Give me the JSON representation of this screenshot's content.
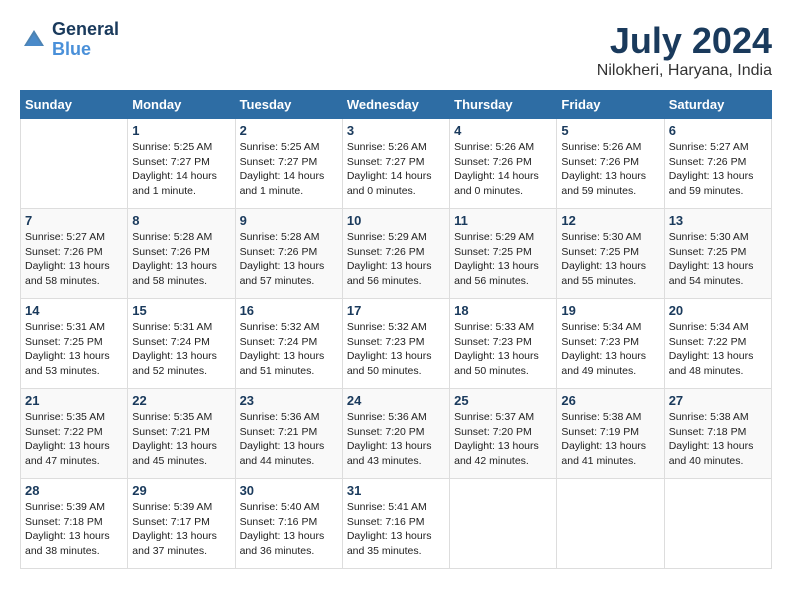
{
  "header": {
    "logo_line1": "General",
    "logo_line2": "Blue",
    "month": "July 2024",
    "location": "Nilokheri, Haryana, India"
  },
  "days_of_week": [
    "Sunday",
    "Monday",
    "Tuesday",
    "Wednesday",
    "Thursday",
    "Friday",
    "Saturday"
  ],
  "weeks": [
    [
      {
        "day": "",
        "info": ""
      },
      {
        "day": "1",
        "info": "Sunrise: 5:25 AM\nSunset: 7:27 PM\nDaylight: 14 hours\nand 1 minute."
      },
      {
        "day": "2",
        "info": "Sunrise: 5:25 AM\nSunset: 7:27 PM\nDaylight: 14 hours\nand 1 minute."
      },
      {
        "day": "3",
        "info": "Sunrise: 5:26 AM\nSunset: 7:27 PM\nDaylight: 14 hours\nand 0 minutes."
      },
      {
        "day": "4",
        "info": "Sunrise: 5:26 AM\nSunset: 7:26 PM\nDaylight: 14 hours\nand 0 minutes."
      },
      {
        "day": "5",
        "info": "Sunrise: 5:26 AM\nSunset: 7:26 PM\nDaylight: 13 hours\nand 59 minutes."
      },
      {
        "day": "6",
        "info": "Sunrise: 5:27 AM\nSunset: 7:26 PM\nDaylight: 13 hours\nand 59 minutes."
      }
    ],
    [
      {
        "day": "7",
        "info": "Sunrise: 5:27 AM\nSunset: 7:26 PM\nDaylight: 13 hours\nand 58 minutes."
      },
      {
        "day": "8",
        "info": "Sunrise: 5:28 AM\nSunset: 7:26 PM\nDaylight: 13 hours\nand 58 minutes."
      },
      {
        "day": "9",
        "info": "Sunrise: 5:28 AM\nSunset: 7:26 PM\nDaylight: 13 hours\nand 57 minutes."
      },
      {
        "day": "10",
        "info": "Sunrise: 5:29 AM\nSunset: 7:26 PM\nDaylight: 13 hours\nand 56 minutes."
      },
      {
        "day": "11",
        "info": "Sunrise: 5:29 AM\nSunset: 7:25 PM\nDaylight: 13 hours\nand 56 minutes."
      },
      {
        "day": "12",
        "info": "Sunrise: 5:30 AM\nSunset: 7:25 PM\nDaylight: 13 hours\nand 55 minutes."
      },
      {
        "day": "13",
        "info": "Sunrise: 5:30 AM\nSunset: 7:25 PM\nDaylight: 13 hours\nand 54 minutes."
      }
    ],
    [
      {
        "day": "14",
        "info": "Sunrise: 5:31 AM\nSunset: 7:25 PM\nDaylight: 13 hours\nand 53 minutes."
      },
      {
        "day": "15",
        "info": "Sunrise: 5:31 AM\nSunset: 7:24 PM\nDaylight: 13 hours\nand 52 minutes."
      },
      {
        "day": "16",
        "info": "Sunrise: 5:32 AM\nSunset: 7:24 PM\nDaylight: 13 hours\nand 51 minutes."
      },
      {
        "day": "17",
        "info": "Sunrise: 5:32 AM\nSunset: 7:23 PM\nDaylight: 13 hours\nand 50 minutes."
      },
      {
        "day": "18",
        "info": "Sunrise: 5:33 AM\nSunset: 7:23 PM\nDaylight: 13 hours\nand 50 minutes."
      },
      {
        "day": "19",
        "info": "Sunrise: 5:34 AM\nSunset: 7:23 PM\nDaylight: 13 hours\nand 49 minutes."
      },
      {
        "day": "20",
        "info": "Sunrise: 5:34 AM\nSunset: 7:22 PM\nDaylight: 13 hours\nand 48 minutes."
      }
    ],
    [
      {
        "day": "21",
        "info": "Sunrise: 5:35 AM\nSunset: 7:22 PM\nDaylight: 13 hours\nand 47 minutes."
      },
      {
        "day": "22",
        "info": "Sunrise: 5:35 AM\nSunset: 7:21 PM\nDaylight: 13 hours\nand 45 minutes."
      },
      {
        "day": "23",
        "info": "Sunrise: 5:36 AM\nSunset: 7:21 PM\nDaylight: 13 hours\nand 44 minutes."
      },
      {
        "day": "24",
        "info": "Sunrise: 5:36 AM\nSunset: 7:20 PM\nDaylight: 13 hours\nand 43 minutes."
      },
      {
        "day": "25",
        "info": "Sunrise: 5:37 AM\nSunset: 7:20 PM\nDaylight: 13 hours\nand 42 minutes."
      },
      {
        "day": "26",
        "info": "Sunrise: 5:38 AM\nSunset: 7:19 PM\nDaylight: 13 hours\nand 41 minutes."
      },
      {
        "day": "27",
        "info": "Sunrise: 5:38 AM\nSunset: 7:18 PM\nDaylight: 13 hours\nand 40 minutes."
      }
    ],
    [
      {
        "day": "28",
        "info": "Sunrise: 5:39 AM\nSunset: 7:18 PM\nDaylight: 13 hours\nand 38 minutes."
      },
      {
        "day": "29",
        "info": "Sunrise: 5:39 AM\nSunset: 7:17 PM\nDaylight: 13 hours\nand 37 minutes."
      },
      {
        "day": "30",
        "info": "Sunrise: 5:40 AM\nSunset: 7:16 PM\nDaylight: 13 hours\nand 36 minutes."
      },
      {
        "day": "31",
        "info": "Sunrise: 5:41 AM\nSunset: 7:16 PM\nDaylight: 13 hours\nand 35 minutes."
      },
      {
        "day": "",
        "info": ""
      },
      {
        "day": "",
        "info": ""
      },
      {
        "day": "",
        "info": ""
      }
    ]
  ]
}
